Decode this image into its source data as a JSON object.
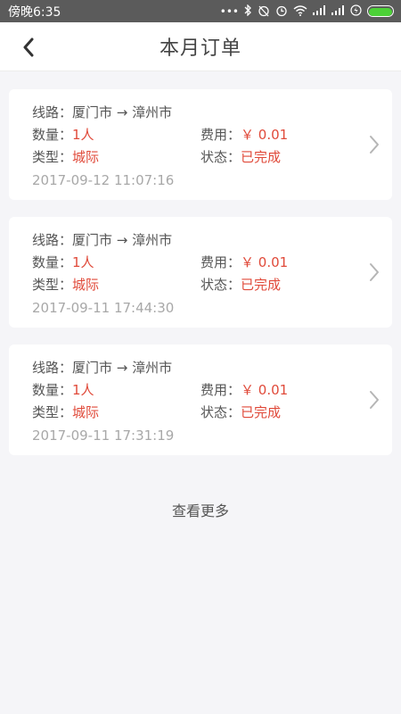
{
  "status_bar": {
    "time": "傍晚6:35",
    "icons": [
      "dots-icon",
      "bluetooth-icon",
      "alarm-off-icon",
      "clock-icon",
      "wifi-icon",
      "signal-icon",
      "signal-icon",
      "charging-icon",
      "battery-icon"
    ],
    "colors": {
      "background": "#5b5b5b",
      "battery": "#4cd137"
    }
  },
  "header": {
    "title": "本月订单",
    "back_icon": "chevron-left-icon"
  },
  "labels": {
    "route": "线路：",
    "quantity": "数量：",
    "type": "类型：",
    "fee": "费用：",
    "status": "状态："
  },
  "orders": [
    {
      "route": "厦门市 → 漳州市",
      "quantity": "1人",
      "type": "城际",
      "fee": "￥ 0.01",
      "status": "已完成",
      "time": "2017-09-12 11:07:16"
    },
    {
      "route": "厦门市 → 漳州市",
      "quantity": "1人",
      "type": "城际",
      "fee": "￥ 0.01",
      "status": "已完成",
      "time": "2017-09-11 17:44:30"
    },
    {
      "route": "厦门市 → 漳州市",
      "quantity": "1人",
      "type": "城际",
      "fee": "￥ 0.01",
      "status": "已完成",
      "time": "2017-09-11 17:31:19"
    }
  ],
  "more_label": "查看更多",
  "colors": {
    "accent": "#e04a3a",
    "page_bg": "#f5f5f8"
  }
}
